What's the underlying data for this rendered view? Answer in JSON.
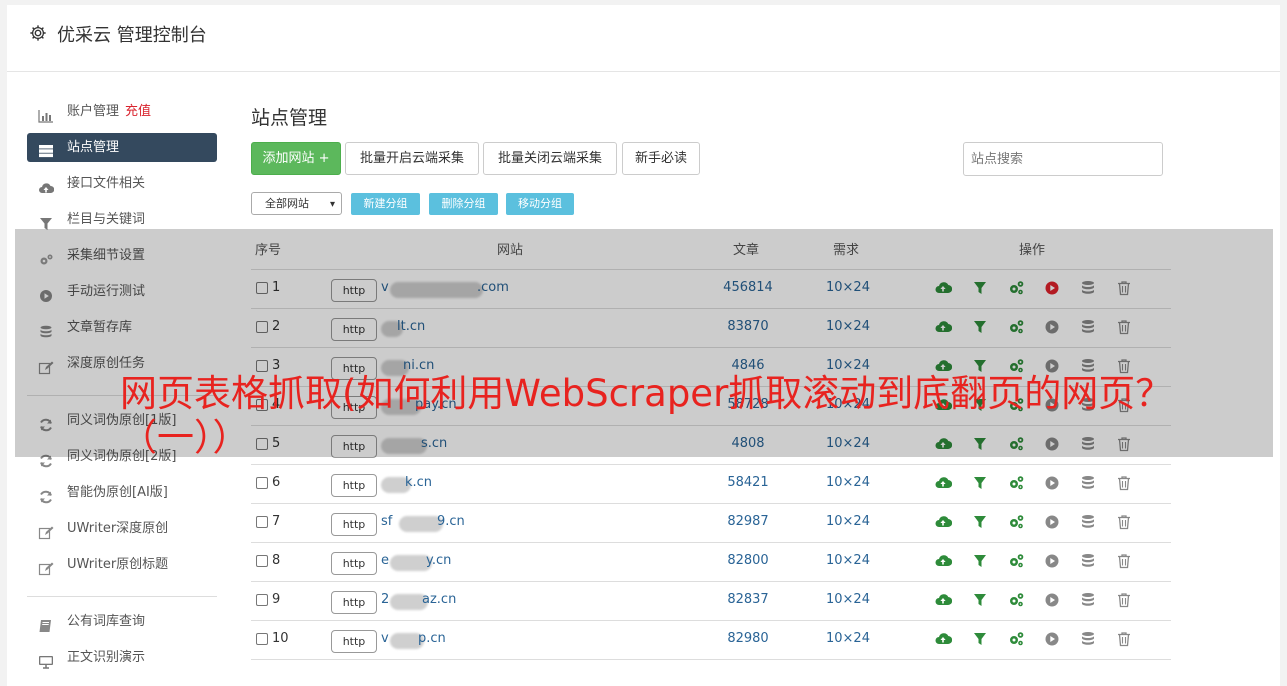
{
  "app": {
    "title": "优采云 管理控制台"
  },
  "sidebar": {
    "items": [
      {
        "label": "账户管理",
        "extra": "充值",
        "icon": "bar-chart-icon"
      },
      {
        "label": "站点管理",
        "icon": "server-icon",
        "active": true
      },
      {
        "label": "接口文件相关",
        "icon": "cloud-upload-icon"
      },
      {
        "label": "栏目与关键词",
        "icon": "filter-icon"
      },
      {
        "label": "采集细节设置",
        "icon": "gears-icon"
      },
      {
        "label": "手动运行测试",
        "icon": "play-circle-icon"
      },
      {
        "label": "文章暂存库",
        "icon": "database-icon"
      },
      {
        "label": "深度原创任务",
        "icon": "edit-icon"
      },
      {
        "label": "同义词伪原创[1版]",
        "icon": "refresh-icon"
      },
      {
        "label": "同义词伪原创[2版]",
        "icon": "refresh-icon"
      },
      {
        "label": "智能伪原创[AI版]",
        "icon": "refresh-icon"
      },
      {
        "label": "UWriter深度原创",
        "icon": "edit-icon"
      },
      {
        "label": "UWriter原创标题",
        "icon": "edit-icon"
      },
      {
        "label": "公有词库查询",
        "icon": "book-icon"
      },
      {
        "label": "正文识别演示",
        "icon": "monitor-icon"
      }
    ]
  },
  "main": {
    "title": "站点管理",
    "buttons": {
      "add_site": "添加网站 +",
      "batch_open": "批量开启云端采集",
      "batch_close": "批量关闭云端采集",
      "beginner": "新手必读"
    },
    "search_placeholder": "站点搜索",
    "group_select": "全部网站",
    "group_buttons": {
      "new": "新建分组",
      "delete": "删除分组",
      "move": "移动分组"
    },
    "table": {
      "headers": {
        "index": "序号",
        "site": "网站",
        "articles": "文章",
        "demand": "需求",
        "actions": "操作"
      },
      "rows": [
        {
          "num": "1",
          "proto": "http",
          "site_prefix": "v",
          "site_suffix": ".com",
          "articles": "456814",
          "demand": "10×24",
          "run_active": true
        },
        {
          "num": "2",
          "proto": "http",
          "site_prefix": "",
          "site_suffix": "lt.cn",
          "articles": "83870",
          "demand": "10×24",
          "run_active": false
        },
        {
          "num": "3",
          "proto": "http",
          "site_prefix": "",
          "site_suffix": "ni.cn",
          "articles": "4846",
          "demand": "10×24",
          "run_active": false
        },
        {
          "num": "4",
          "proto": "http",
          "site_prefix": "",
          "site_suffix": "pay.cn",
          "articles": "58728",
          "demand": "10×24",
          "run_active": false
        },
        {
          "num": "5",
          "proto": "http",
          "site_prefix": "",
          "site_suffix": "s.cn",
          "articles": "4808",
          "demand": "10×24",
          "run_active": false
        },
        {
          "num": "6",
          "proto": "http",
          "site_prefix": "",
          "site_suffix": "k.cn",
          "articles": "58421",
          "demand": "10×24",
          "run_active": false
        },
        {
          "num": "7",
          "proto": "http",
          "site_prefix": "sf",
          "site_suffix": "9.cn",
          "articles": "82987",
          "demand": "10×24",
          "run_active": false
        },
        {
          "num": "8",
          "proto": "http",
          "site_prefix": "e",
          "site_suffix": "y.cn",
          "articles": "82800",
          "demand": "10×24",
          "run_active": false
        },
        {
          "num": "9",
          "proto": "http",
          "site_prefix": "2",
          "site_suffix": "az.cn",
          "articles": "82837",
          "demand": "10×24",
          "run_active": false
        },
        {
          "num": "10",
          "proto": "http",
          "site_prefix": "v",
          "site_suffix": "p.cn",
          "articles": "82980",
          "demand": "10×24",
          "run_active": false
        }
      ]
    }
  },
  "overlay": {
    "headline": "网页表格抓取(如何利用WebScraper抓取滚动到底翻页的网页？（一））"
  },
  "colors": {
    "accent_dark": "#34495e",
    "green": "#5cb85c",
    "info": "#5bc0de",
    "link": "#2a6496",
    "headline_red": "#e8231f",
    "run_red": "#e0212b"
  }
}
